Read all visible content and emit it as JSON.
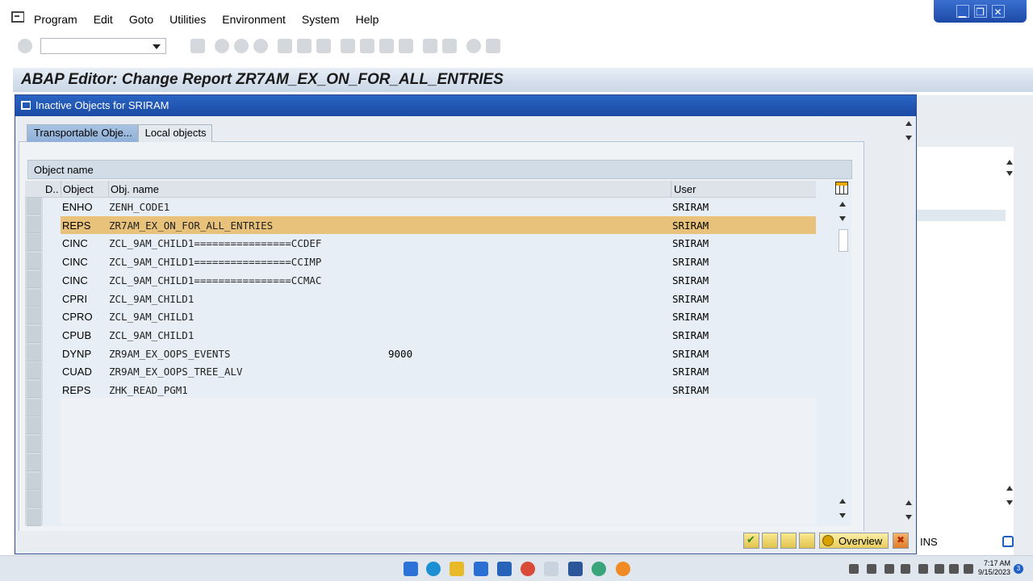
{
  "menu": {
    "items": [
      "Program",
      "Edit",
      "Goto",
      "Utilities",
      "Environment",
      "System",
      "Help"
    ]
  },
  "window_controls": {
    "minimize": "▁",
    "restore": "❐",
    "close": "✕"
  },
  "toolbar": {
    "command_field_value": ""
  },
  "screen_title": "ABAP Editor: Change Report ZR7AM_EX_ON_FOR_ALL_ENTRIES",
  "dialog": {
    "title": "Inactive Objects for SRIRAM",
    "tabs": [
      {
        "label": "Transportable Obje...",
        "active": true
      },
      {
        "label": "Local objects",
        "active": false
      }
    ],
    "grid_title": "Object name",
    "columns": {
      "d": "D..",
      "object": "Object",
      "obj_name": "Obj. name",
      "user": "User"
    },
    "rows": [
      {
        "object": "ENHO",
        "name": "ZENH_CODE1",
        "num": "",
        "user": "SRIRAM"
      },
      {
        "object": "REPS",
        "name": "ZR7AM_EX_ON_FOR_ALL_ENTRIES",
        "num": "",
        "user": "SRIRAM",
        "selected": true
      },
      {
        "object": "CINC",
        "name": "ZCL_9AM_CHILD1================CCDEF",
        "num": "",
        "user": "SRIRAM"
      },
      {
        "object": "CINC",
        "name": "ZCL_9AM_CHILD1================CCIMP",
        "num": "",
        "user": "SRIRAM"
      },
      {
        "object": "CINC",
        "name": "ZCL_9AM_CHILD1================CCMAC",
        "num": "",
        "user": "SRIRAM"
      },
      {
        "object": "CPRI",
        "name": "ZCL_9AM_CHILD1",
        "num": "",
        "user": "SRIRAM"
      },
      {
        "object": "CPRO",
        "name": "ZCL_9AM_CHILD1",
        "num": "",
        "user": "SRIRAM"
      },
      {
        "object": "CPUB",
        "name": "ZCL_9AM_CHILD1",
        "num": "",
        "user": "SRIRAM"
      },
      {
        "object": "DYNP",
        "name": "ZR9AM_EX_OOPS_EVENTS",
        "num": "9000",
        "user": "SRIRAM"
      },
      {
        "object": "CUAD",
        "name": "ZR9AM_EX_OOPS_TREE_ALV",
        "num": "",
        "user": "SRIRAM"
      },
      {
        "object": "REPS",
        "name": "ZHK_READ_PGM1",
        "num": "",
        "user": "SRIRAM"
      }
    ],
    "footer": {
      "overview_label": "Overview"
    }
  },
  "status": {
    "mode": "INS"
  },
  "taskbar": {
    "time": "7:17 AM",
    "date": "9/15/2023",
    "notifications": "3"
  },
  "colors": {
    "selected_row": "#e8c27a",
    "dialog_title": "#1f55b4"
  }
}
